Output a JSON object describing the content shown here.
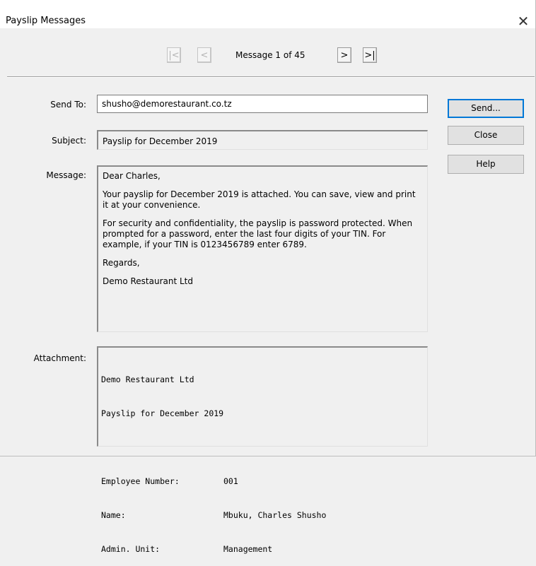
{
  "window": {
    "title": "Payslip Messages",
    "close_symbol": "✕"
  },
  "nav": {
    "first": "|<",
    "prev": "<",
    "message_counter": "Message 1 of 45",
    "next": ">",
    "last": ">|"
  },
  "form": {
    "send_to_label": "Send To:",
    "send_to_value": "shusho@demorestaurant.co.tz",
    "subject_label": "Subject:",
    "subject_value": "Payslip for December 2019",
    "message_label": "Message:",
    "message_paragraphs": [
      "Dear Charles,",
      "Your payslip for December 2019 is attached. You can save, view and print it at your convenience.",
      "For security and confidentiality, the payslip is password protected. When prompted for a password, enter the last four digits of your TIN. For example, if your TIN is 0123456789 enter 6789.",
      "Regards,",
      "Demo Restaurant Ltd"
    ],
    "attachment_label": "Attachment:",
    "attachment": {
      "company": "Demo Restaurant Ltd",
      "heading": "Payslip for December 2019",
      "rows": [
        {
          "key": "Employee Number:",
          "value": "001"
        },
        {
          "key": "Name:",
          "value": "Mbuku, Charles Shusho"
        },
        {
          "key": "Admin. Unit:",
          "value": "Management"
        }
      ]
    }
  },
  "buttons": {
    "send": "Send...",
    "close": "Close",
    "help": "Help"
  }
}
